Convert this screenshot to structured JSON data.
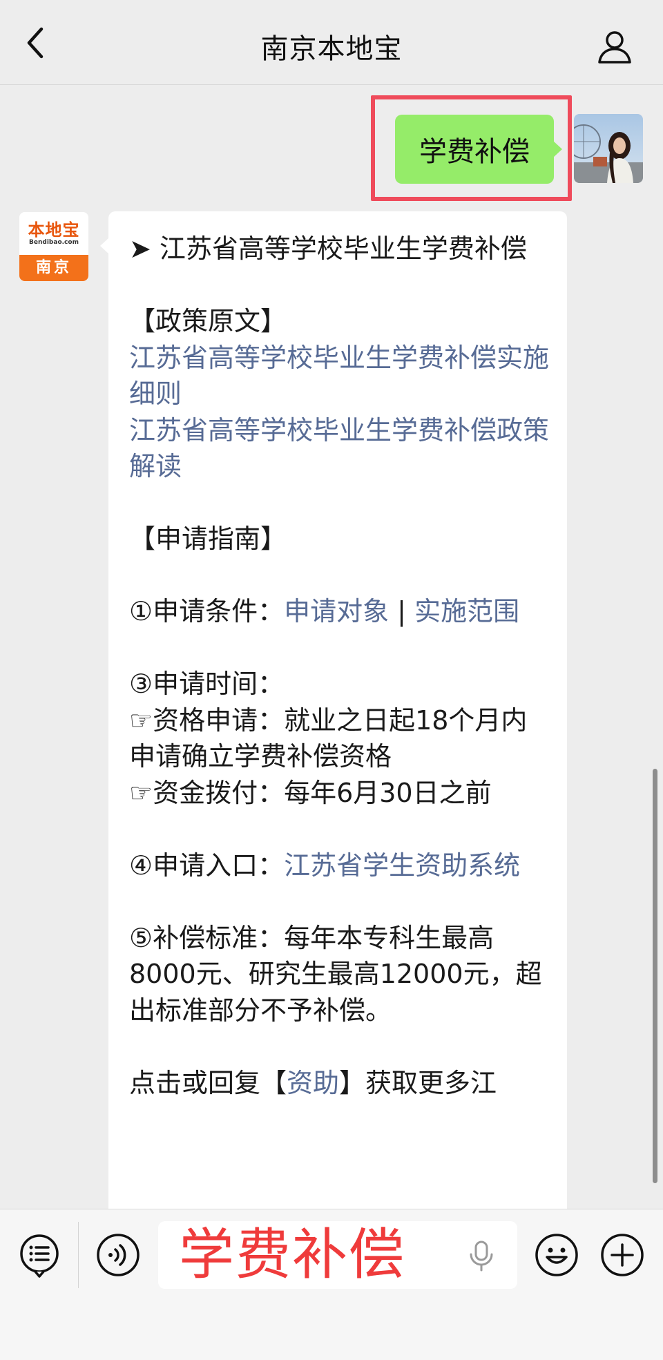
{
  "header": {
    "title": "南京本地宝"
  },
  "my_message": {
    "text": "学费补偿"
  },
  "bot": {
    "avatar_text_top": "本地宝",
    "avatar_text_en": "Bendibao.com",
    "avatar_text_bottom": "南京",
    "heading": "➤ 江苏省高等学校毕业生学费补偿",
    "policy_title": "【政策原文】",
    "policy_link_1": "江苏省高等学校毕业生学费补偿实施细则",
    "policy_link_2": "江苏省高等学校毕业生学费补偿政策解读",
    "guide_title": "【申请指南】",
    "condition_label": "①申请条件：",
    "condition_link_1": "申请对象",
    "condition_sep": " | ",
    "condition_link_2": "实施范围",
    "time_label": "③申请时间：",
    "time_qualify": "☞资格申请：就业之日起18个月内申请确立学费补偿资格",
    "time_fund": "☞资金拨付：每年6月30日之前",
    "entry_label": "④申请入口：",
    "entry_link": "江苏省学生资助系统",
    "standard": "⑤补偿标准：每年本专科生最高8000元、研究生最高12000元，超出标准部分不予补偿。",
    "more_prefix": "点击或回复【",
    "more_link": "资助",
    "more_suffix": "】获取更多江"
  },
  "input": {
    "text": "学费补偿"
  },
  "icons": {
    "back": "chevron-left-icon",
    "user": "user-icon",
    "menu": "menu-list-icon",
    "voice": "voice-icon",
    "mic": "mic-icon",
    "emoji": "emoji-icon",
    "plus": "plus-icon"
  },
  "colors": {
    "my_bubble": "#95ec69",
    "link": "#576b95",
    "highlight": "#ef4b5b",
    "input_text": "#ef3b3b"
  }
}
